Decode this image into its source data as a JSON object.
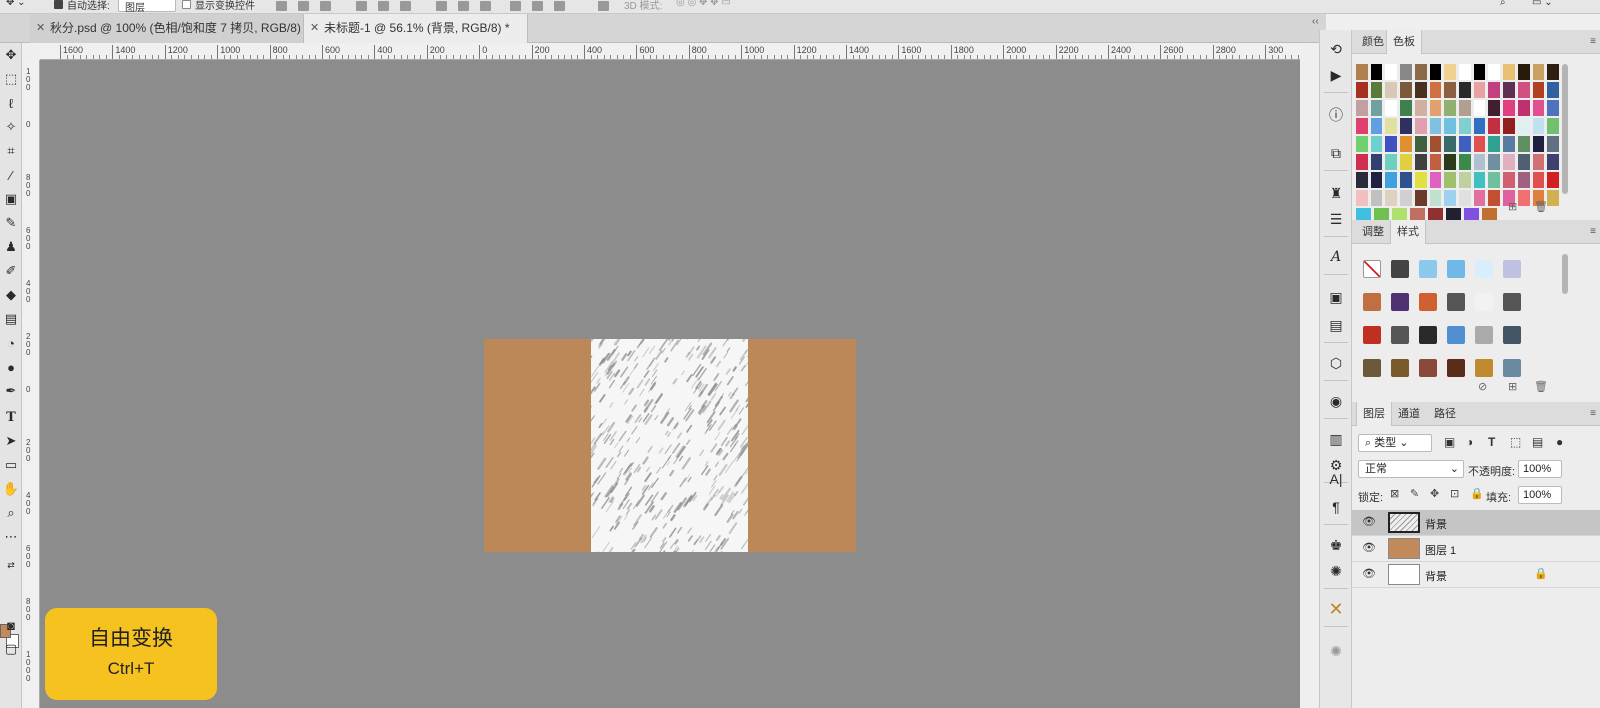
{
  "options_bar": {
    "auto_select_label": "自动选择:",
    "auto_select_value": "图层",
    "show_transform_label": "显示变换控件",
    "mode_3d_label": "3D 模式:"
  },
  "tabs": [
    {
      "label": "秋分.psd @ 100% (色相/饱和度 7 拷贝, RGB/8)",
      "active": false
    },
    {
      "label": "未标题-1 @ 56.1% (背景, RGB/8) *",
      "active": true
    }
  ],
  "ruler": {
    "top_labels": [
      "1600",
      "1400",
      "1200",
      "1000",
      "800",
      "600",
      "400",
      "200",
      "0",
      "200",
      "400",
      "600",
      "800",
      "1000",
      "1200",
      "1400",
      "1600",
      "1800",
      "2000",
      "2200",
      "2400",
      "2600",
      "2800",
      "300"
    ],
    "left_labels": [
      "100",
      "0",
      "800",
      "600",
      "400",
      "200",
      "0",
      "200",
      "400",
      "600",
      "800",
      "1000"
    ]
  },
  "shortcut": {
    "title": "自由变换",
    "keys": "Ctrl+T"
  },
  "swatches_panel": {
    "tabs": [
      "颜色",
      "色板"
    ],
    "active_tab": "色板",
    "rows": [
      [
        "#b08050",
        "#000000",
        "#ffffff",
        "#888888",
        "#8a6a4a",
        "#000000",
        "#f0d090",
        "#ffffff",
        "#000000",
        "#ffffff",
        "#e8c070",
        "#2a1a0a",
        "#c8a060",
        "#2e2010"
      ],
      [
        "#a83020",
        "#5a7a3a",
        "#d8c8b8",
        "#7a5a3a",
        "#4a3020",
        "#d07040",
        "#8a6040",
        "#2a2a2a",
        "#e8a0a0",
        "#c04080",
        "#603050",
        "#d05080",
        "#b04020",
        "#3060a0"
      ],
      [
        "#c0a0a0",
        "#70a0a0",
        "#ffffff",
        "#408050",
        "#d0b0a0",
        "#e0a070",
        "#90b070",
        "#b0a090",
        "#ffffff",
        "#402030",
        "#e04080",
        "#c03070",
        "#e05090",
        "#5070c0"
      ],
      [
        "#e04070",
        "#60a0e0",
        "#e0e0a0",
        "#303060",
        "#e0a0b0",
        "#80c0e0",
        "#70c0e0",
        "#80d0d0",
        "#3070c0",
        "#c03040",
        "#902020",
        "#e0f0f0",
        "#c0e0f0",
        "#70c070"
      ],
      [
        "#70d070",
        "#70d0d0",
        "#4050c0",
        "#e09030",
        "#406040",
        "#a05030",
        "#3a6a6a",
        "#4060c0",
        "#e05050",
        "#30a090",
        "#5a7aa0",
        "#609060",
        "#202040",
        "#607080"
      ],
      [
        "#d03050",
        "#304070",
        "#70d0c0",
        "#e0d040",
        "#404040",
        "#c06040",
        "#2a3a1a",
        "#3a8a4a",
        "#b0c0d0",
        "#7090a0",
        "#e0b0c0",
        "#506070",
        "#d07070",
        "#404070"
      ],
      [
        "#2a2a3a",
        "#202040",
        "#40a0e0",
        "#305090",
        "#e0e040",
        "#e060c0",
        "#a0c070",
        "#c0d0a0",
        "#40c0c0",
        "#70c0a0",
        "#d06070",
        "#a06080",
        "#e05050",
        "#d02020"
      ],
      [
        "#f0c0c0",
        "#c0c0c0",
        "#e0d0c0",
        "#d0d0d0",
        "#6a3a2a",
        "#c0e0d0",
        "#a0d0f0",
        "#e0e0e0",
        "#e070a0",
        "#c05030",
        "#e060a0",
        "#f07070",
        "#e08040",
        "#d0b050"
      ],
      [
        "#40c0e0",
        "#70c050",
        "#b0e070",
        "#c07060",
        "#903030",
        "#202030",
        "#8050e0",
        "#c07030"
      ]
    ]
  },
  "styles_panel": {
    "tabs": [
      "调整",
      "样式"
    ],
    "active_tab": "样式",
    "rows": [
      [
        "#ffffff",
        "#444444",
        "#8ac8ec",
        "#70b8e8",
        "#d8eefc",
        "#c0c0e0"
      ],
      [
        "#c07040",
        "#503070",
        "#d06030",
        "#555555",
        "#f2f2f2",
        "#555555"
      ],
      [
        "#c03020",
        "#555555",
        "#2a2a2a",
        "#5090d0",
        "#aaaaaa",
        "#445566"
      ],
      [
        "#6a5a3a",
        "#7a5a2a",
        "#8a4a3a",
        "#5a2a1a",
        "#c08a30",
        "#6a8aa0"
      ]
    ]
  },
  "layers_panel": {
    "tabs": [
      "图层",
      "通道",
      "路径"
    ],
    "active_tab": "图层",
    "filter_label": "类型",
    "blend_mode": "正常",
    "opacity_label": "不透明度:",
    "opacity_value": "100%",
    "lock_label": "锁定:",
    "fill_label": "填充:",
    "fill_value": "100%",
    "layers": [
      {
        "name": "背景",
        "thumb": "texture",
        "selected": true,
        "locked": false
      },
      {
        "name": "图层 1",
        "thumb": "#c08a5a",
        "selected": false,
        "locked": false
      },
      {
        "name": "背景",
        "thumb": "#ffffff",
        "selected": false,
        "locked": true
      }
    ]
  },
  "colors": {
    "canvas_bg": "#8c8c8c",
    "document_brown": "#bc8858",
    "foreground": "#c18a59",
    "background": "#ffffff",
    "hint_card": "#f5c21f"
  }
}
